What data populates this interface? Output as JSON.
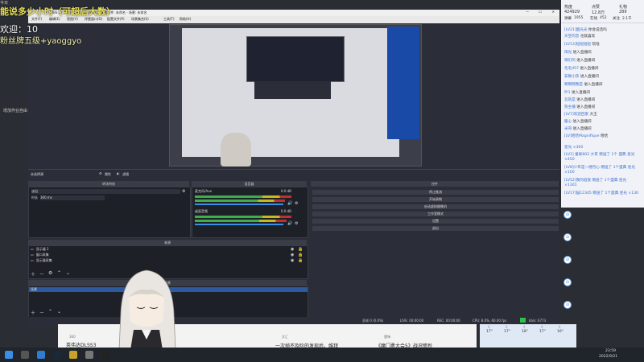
{
  "overlay": {
    "line1": "能说多少小时（可超后大数）",
    "line2": "欢迎：10",
    "line3": "粉丝牌五级+yaoggyo",
    "top_small": "今日",
    "sidebar_hint": "增加作业自由"
  },
  "obs": {
    "title": "OBS 27.2.4 (64-bit, windows) - 配置文件: 未命名 - 场景: 未命名",
    "menus": [
      "文件(F)",
      "编辑(E)",
      "视图(V)",
      "停靠窗口(D)",
      "配置文件(P)",
      "场景集合(S)",
      "工具(T)",
      "帮助(H)"
    ],
    "source_label": "未选择源",
    "toolbar_props": "属性",
    "toolbar_filters": "滤镜",
    "panels": {
      "transition_head": "转场特效",
      "mixer_head": "混音器",
      "controls_head": "控件",
      "sources_head": "来源",
      "scenes_head": "场景"
    },
    "transition": {
      "selected": "淡出",
      "duration_label": "时长",
      "duration_value": "300 ms"
    },
    "mixer": [
      {
        "name": "麦克风/Aux",
        "db": "0.0 dB"
      },
      {
        "name": "桌面音频",
        "db": "0.0 dB"
      }
    ],
    "controls": [
      "停止推流",
      "开始录制",
      "启动虚拟摄像机",
      "工作室模式",
      "设置",
      "退出"
    ],
    "sources": [
      "显示器 2",
      "窗口采集",
      "显示器采集"
    ],
    "scenes": [
      "场景"
    ],
    "status": {
      "dropped": "丢帧 0 (0.0%)",
      "live": "LIVE: 00:00:00",
      "rec": "REC: 00:00:00",
      "cpu": "CPU: 8.0%, 60.00 fps",
      "kbps": "kb/s: 6773"
    }
  },
  "chat": {
    "stats": [
      {
        "label": "热度",
        "value": "424929"
      },
      {
        "label": "点赞",
        "value": "12.8万"
      },
      {
        "label": "礼物",
        "value": "289"
      },
      {
        "label": "弹幕",
        "value": "1955"
      },
      {
        "label": "在线",
        "value": "452"
      },
      {
        "label": "关注",
        "value": "2.1千"
      }
    ],
    "lines": [
      {
        "user": "[LV21]国光光",
        "text": "你会说话吗"
      },
      {
        "user": "天空的恋",
        "text": "也就喜欢"
      },
      {
        "user": "[LV13]短短短短",
        "text": "玩啥"
      },
      {
        "user": "阳光",
        "text": "进入直播间"
      },
      {
        "user": "嗨们的",
        "text": "进入直播间"
      },
      {
        "user": "毛毛457",
        "text": "进入直播间"
      },
      {
        "user": "安静小孩",
        "text": "进入直播间"
      },
      {
        "user": "啊啊啊我是",
        "text": "进入直播间"
      },
      {
        "user": "叶1",
        "text": "进入直播间"
      },
      {
        "user": "吾就是",
        "text": "进入直播间"
      },
      {
        "user": "狗主播",
        "text": "进入直播间"
      },
      {
        "user": "[LV7]欢迎回家",
        "text": "大王"
      },
      {
        "user": "暖心",
        "text": "进入直播间"
      },
      {
        "user": "米哥",
        "text": "进入直播间"
      },
      {
        "user": "[LV]哈哈Magnifique",
        "text": "哈哈"
      }
    ],
    "gifts": [
      "星光 ×360",
      "[LV1] 童嫁802 大哥 赠送了 1个 盛典 星光 ×450",
      "[LV8]少年是一缕月心 赠送了 1个盛典 星光 ×100",
      "[LV52]我的宿放 赠送了 1个盛典 星光 ×1301",
      "[LV17]猫12345 赠送了 1个盛典 星光 ×130"
    ]
  },
  "news": [
    {
      "source": "360",
      "title": "英伟达DLSS3"
    },
    {
      "source": "文汇",
      "title": "一次抛不及阶的发现后，维拜"
    },
    {
      "source": "雷锋",
      "title": "《魔门勇大会5》战况惨烈"
    }
  ],
  "weather": {
    "temps": [
      "17°",
      "17°",
      "18°",
      "17°",
      "16°"
    ]
  },
  "taskbar": {
    "time": "23:59",
    "date": "2022/9/21"
  }
}
